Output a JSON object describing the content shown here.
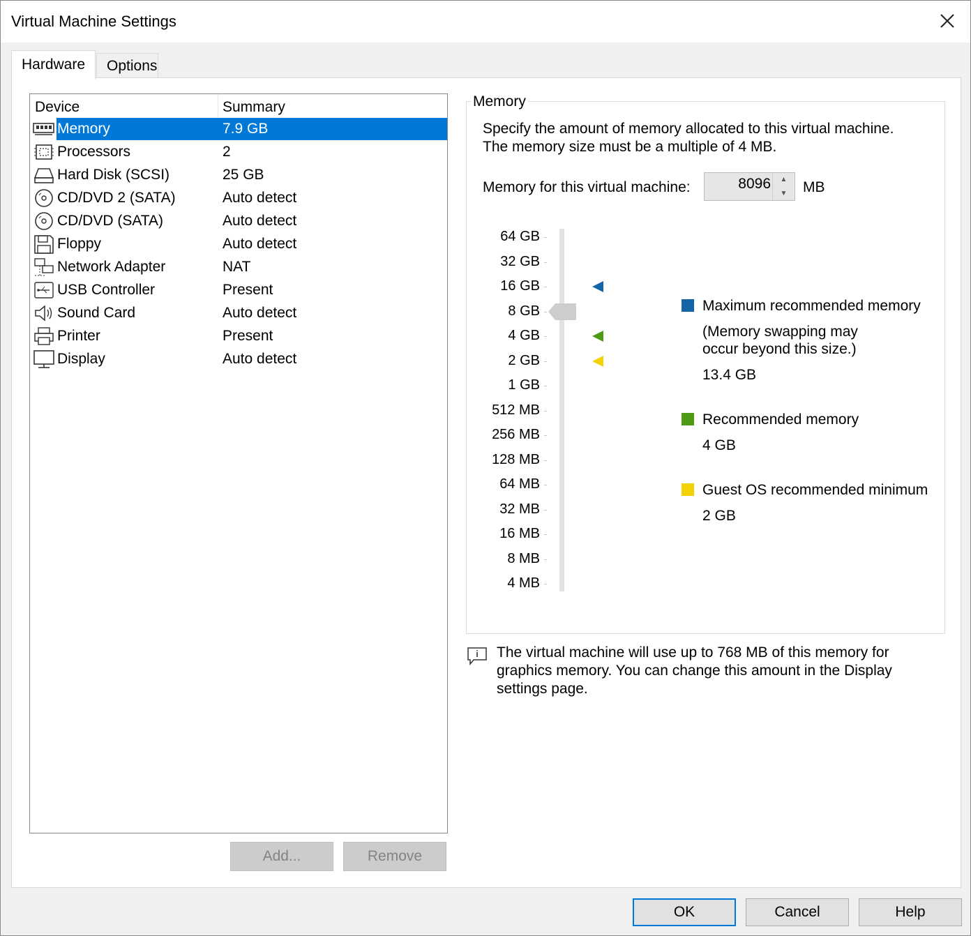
{
  "window": {
    "title": "Virtual Machine Settings"
  },
  "tabs": [
    {
      "label": "Hardware",
      "active": true
    },
    {
      "label": "Options",
      "active": false
    }
  ],
  "device_list": {
    "headers": {
      "device": "Device",
      "summary": "Summary"
    },
    "rows": [
      {
        "icon": "memory-icon",
        "name": "Memory",
        "summary": "7.9 GB",
        "selected": true
      },
      {
        "icon": "processor-icon",
        "name": "Processors",
        "summary": "2"
      },
      {
        "icon": "hard-disk-icon",
        "name": "Hard Disk (SCSI)",
        "summary": "25 GB"
      },
      {
        "icon": "cd-dvd-icon",
        "name": "CD/DVD 2 (SATA)",
        "summary": "Auto detect"
      },
      {
        "icon": "cd-dvd-icon",
        "name": "CD/DVD (SATA)",
        "summary": "Auto detect"
      },
      {
        "icon": "floppy-icon",
        "name": "Floppy",
        "summary": "Auto detect"
      },
      {
        "icon": "network-adapter-icon",
        "name": "Network Adapter",
        "summary": "NAT"
      },
      {
        "icon": "usb-icon",
        "name": "USB Controller",
        "summary": "Present"
      },
      {
        "icon": "sound-card-icon",
        "name": "Sound Card",
        "summary": "Auto detect"
      },
      {
        "icon": "printer-icon",
        "name": "Printer",
        "summary": "Present"
      },
      {
        "icon": "display-icon",
        "name": "Display",
        "summary": "Auto detect"
      }
    ],
    "add_label": "Add...",
    "remove_label": "Remove"
  },
  "memory": {
    "group_label": "Memory",
    "description_line1": "Specify the amount of memory allocated to this virtual machine.",
    "description_line2": "The memory size must be a multiple of 4 MB.",
    "field_label": "Memory for this virtual machine:",
    "value": "8096",
    "unit": "MB",
    "scale_labels": [
      "64 GB",
      "32 GB",
      "16 GB",
      "8 GB",
      "4 GB",
      "2 GB",
      "1 GB",
      "512 MB",
      "256 MB",
      "128 MB",
      "64 MB",
      "32 MB",
      "16 MB",
      "8 MB",
      "4 MB"
    ],
    "slider_value": "8 GB",
    "markers": [
      {
        "level": "16 GB",
        "color": "#1464a8",
        "kind": "maximum"
      },
      {
        "level": "4 GB",
        "color": "#4f9a14",
        "kind": "recommended"
      },
      {
        "level": "2 GB",
        "color": "#f2d200",
        "kind": "guest-minimum"
      }
    ],
    "legend": {
      "maximum": {
        "label": "Maximum recommended memory",
        "note_line1": "(Memory swapping may",
        "note_line2": "occur beyond this size.)",
        "value": "13.4 GB",
        "color": "#1464a8"
      },
      "recommended": {
        "label": "Recommended memory",
        "value": "4 GB",
        "color": "#4f9a14"
      },
      "guest_minimum": {
        "label": "Guest OS recommended minimum",
        "value": "2 GB",
        "color": "#f2d200"
      }
    },
    "info_line1": "The virtual machine will use up to 768 MB of this memory for",
    "info_line2": "graphics memory. You can change this amount in the Display",
    "info_line3": "settings page."
  },
  "buttons": {
    "ok": "OK",
    "cancel": "Cancel",
    "help": "Help"
  },
  "colors": {
    "selection": "#0078d7",
    "default_button_border": "#0078d7"
  }
}
